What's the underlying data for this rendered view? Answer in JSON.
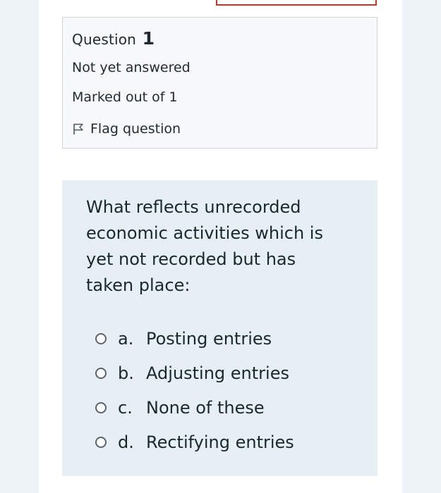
{
  "info": {
    "question_label": "Question",
    "question_number": "1",
    "state": "Not yet answered",
    "grade": "Marked out of 1",
    "flag_label": "Flag question",
    "flag_icon": "flag-icon"
  },
  "question": {
    "text": "What reflects unrecorded economic activities which is yet not recorded but has taken place:",
    "options": [
      {
        "letter": "a.",
        "text": "Posting entries"
      },
      {
        "letter": "b.",
        "text": "Adjusting entries"
      },
      {
        "letter": "c.",
        "text": "None of these"
      },
      {
        "letter": "d.",
        "text": "Rectifying entries"
      }
    ]
  },
  "colors": {
    "page_background": "#eef3f8",
    "info_panel": "#f7f8f9",
    "content_panel": "#e6f0f4",
    "top_box_border": "#c0392b"
  }
}
